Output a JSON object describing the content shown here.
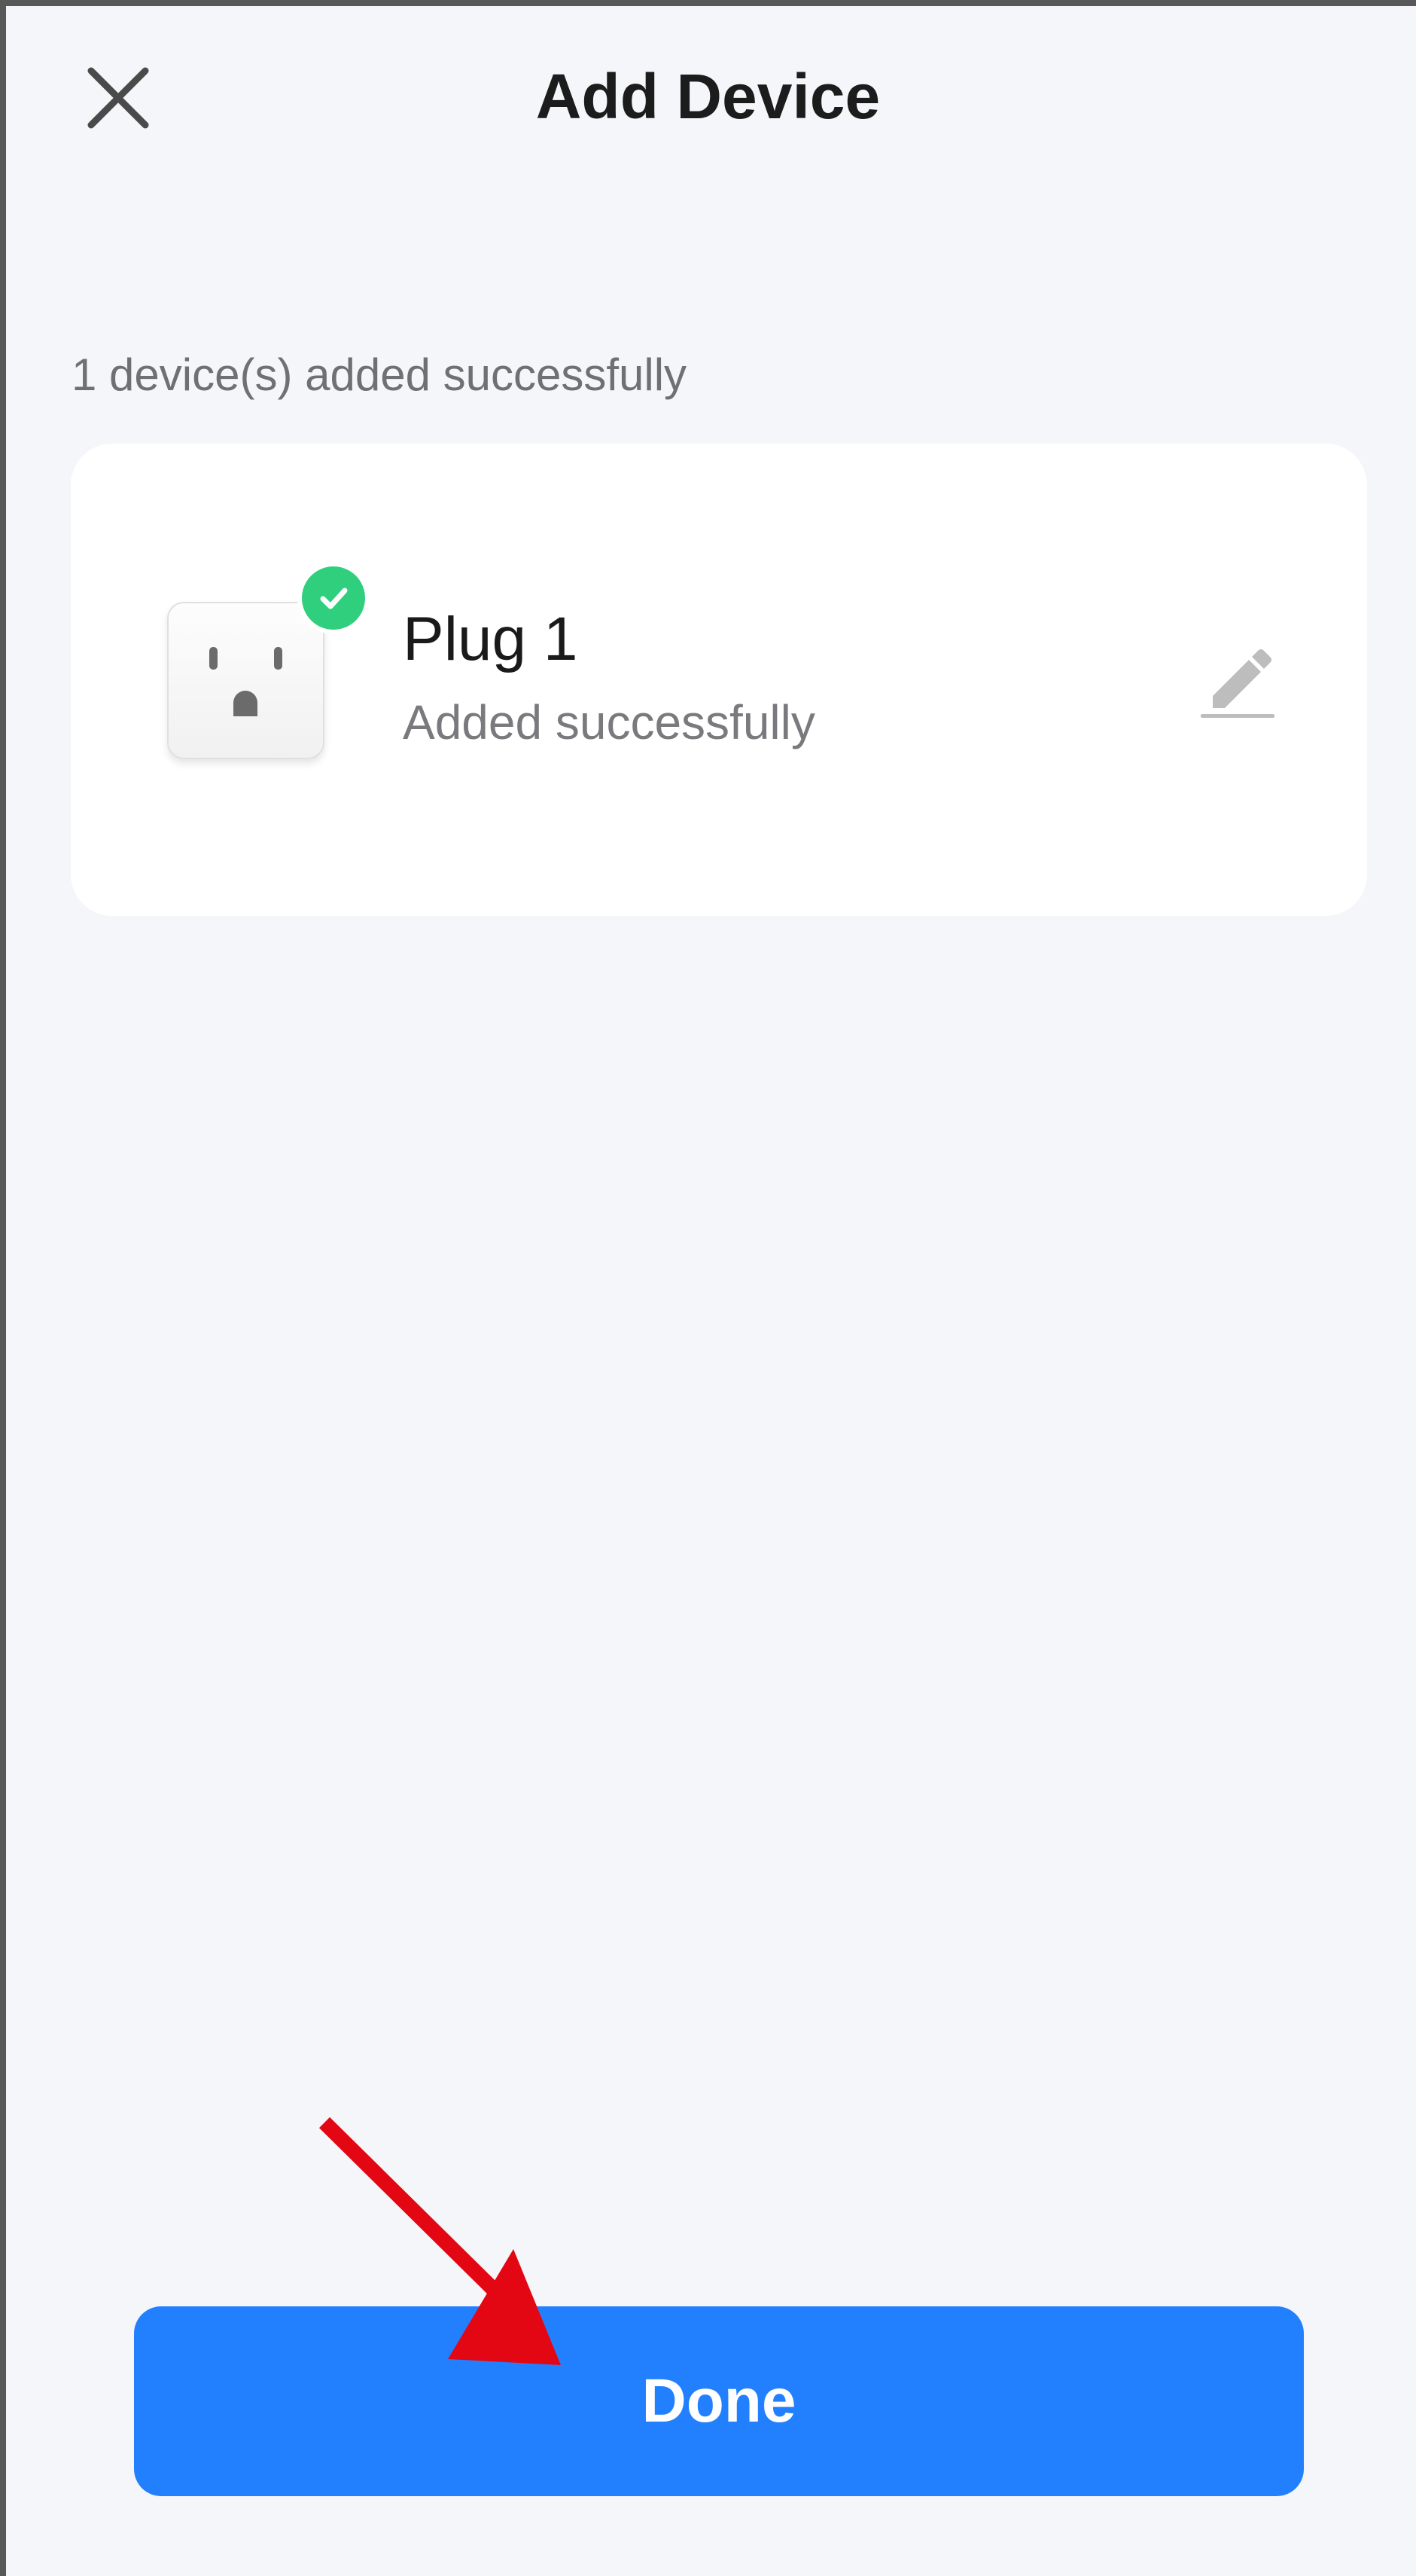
{
  "header": {
    "title": "Add Device",
    "close_icon": "close-icon"
  },
  "summary": {
    "text": "1 device(s) added successfully"
  },
  "device": {
    "name": "Plug 1",
    "status": "Added successfully",
    "image_icon": "smart-plug-icon",
    "badge_icon": "check-circle-icon",
    "edit_icon": "pencil-icon"
  },
  "footer": {
    "done_label": "Done"
  },
  "annotation": {
    "icon": "red-arrow-icon",
    "color": "#e30613"
  },
  "colors": {
    "accent": "#2280ff",
    "success": "#2fcf7d",
    "background": "#f5f6fa",
    "card": "#ffffff"
  }
}
